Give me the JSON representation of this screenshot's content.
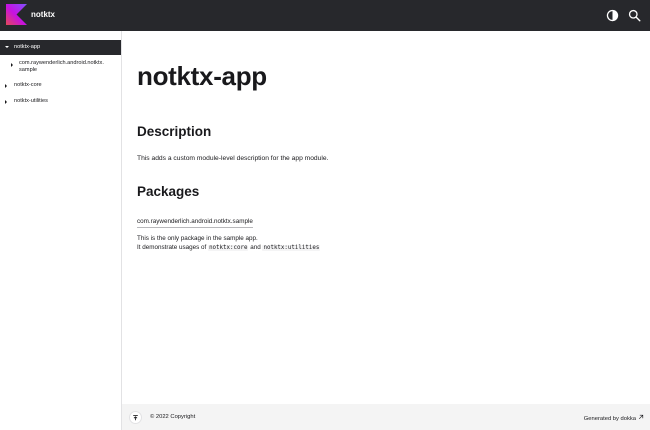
{
  "header": {
    "project_name": "notktx",
    "logo_icon": "kotlin-logo-icon",
    "theme_icon": "theme-toggle-icon",
    "search_icon": "search-icon",
    "colors": {
      "bar": "#27282c",
      "logo_gradient": [
        "#e44857",
        "#c711e1",
        "#7f52ff"
      ]
    }
  },
  "sidebar": {
    "items": [
      {
        "label": "notktx-app",
        "expanded": true,
        "active": true
      },
      {
        "label_line1": "com.raywenderlich.android.notktx.",
        "label_line2": "sample",
        "expanded": false,
        "active": false
      },
      {
        "label": "notktx-core",
        "expanded": false,
        "active": false
      },
      {
        "label": "notktx-utilities",
        "expanded": false,
        "active": false
      }
    ]
  },
  "main": {
    "title": "notktx-app",
    "description_heading": "Description",
    "description_text": "This adds a custom module-level description for the app module.",
    "packages_heading": "Packages",
    "package_name": "com.raywenderlich.android.notktx.sample",
    "package_desc_line1": "This is the only package in the sample app.",
    "package_desc_line2_prefix": "It demonstrate usages of ",
    "code_core": "notktx:core",
    "conjunction": " and ",
    "code_utilities": "notktx:utilities"
  },
  "footer": {
    "copyright": "© 2022 Copyright",
    "generated_prefix": "Generated by ",
    "generated_link": "dokka",
    "external_icon": "external-link-icon",
    "scroll_top_icon": "scroll-top-icon"
  }
}
